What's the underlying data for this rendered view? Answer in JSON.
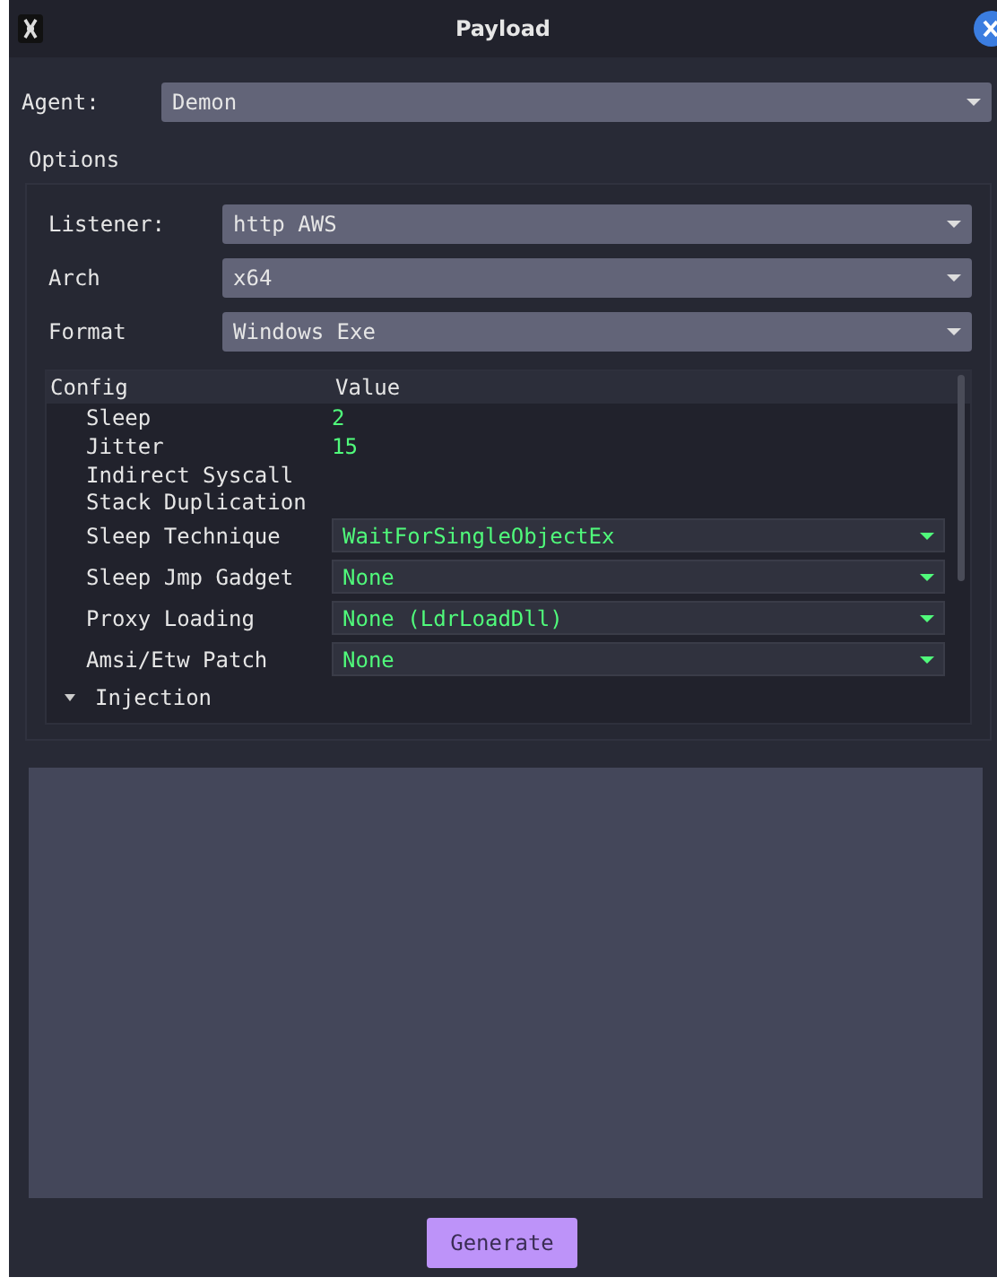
{
  "window": {
    "title": "Payload"
  },
  "agent": {
    "label": "Agent:",
    "value": "Demon"
  },
  "options": {
    "title": "Options",
    "fields": [
      {
        "label": "Listener:",
        "value": "http AWS"
      },
      {
        "label": "Arch",
        "value": "x64"
      },
      {
        "label": "Format",
        "value": "Windows Exe"
      }
    ]
  },
  "config": {
    "columns": [
      "Config",
      "Value"
    ],
    "rows": [
      {
        "kind": "text",
        "name": "Sleep",
        "value": "2"
      },
      {
        "kind": "text",
        "name": "Jitter",
        "value": "15"
      },
      {
        "kind": "label",
        "name": "Indirect Syscall"
      },
      {
        "kind": "label",
        "name": "Stack Duplication"
      },
      {
        "kind": "select",
        "name": "Sleep Technique",
        "value": "WaitForSingleObjectEx"
      },
      {
        "kind": "select",
        "name": "Sleep Jmp Gadget",
        "value": "None"
      },
      {
        "kind": "select",
        "name": "Proxy Loading",
        "value": "None (LdrLoadDll)"
      },
      {
        "kind": "select",
        "name": "Amsi/Etw Patch",
        "value": "None"
      },
      {
        "kind": "group",
        "name": "Injection",
        "expanded": true
      }
    ]
  },
  "buttons": [
    "Generate"
  ]
}
